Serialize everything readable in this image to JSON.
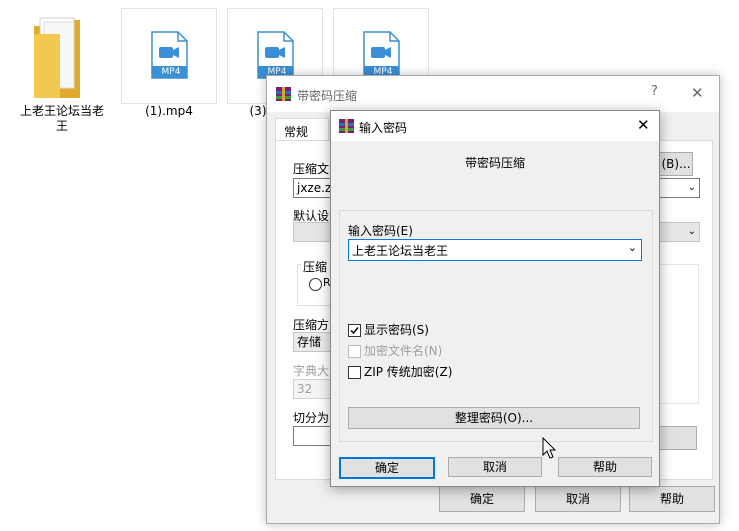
{
  "desktop": {
    "folder_name": "上老王论坛当老王",
    "files": [
      {
        "name": "(1).mp4",
        "badge": "MP4"
      },
      {
        "name": "(3)",
        "badge": "MP4"
      },
      {
        "name": "",
        "badge": "MP4"
      }
    ]
  },
  "back_dialog": {
    "title": "带密码压缩",
    "help_glyph": "?",
    "close_glyph": "✕",
    "tab_general": "常规",
    "label_archive": "压缩文",
    "archive_value": "jxze.zi",
    "browse_btn": "(B)...",
    "label_profile": "默认设",
    "label_format": "压缩",
    "radio_label": "R",
    "label_method": "压缩方",
    "method_value": "存储",
    "label_dict": "字典大",
    "dict_value": "32",
    "label_split": "切分为",
    "ok": "确定",
    "cancel": "取消",
    "help": "帮助"
  },
  "front_dialog": {
    "title": "输入密码",
    "close_glyph": "✕",
    "header": "带密码压缩",
    "password_label": "输入密码(E)",
    "password_value": "上老王论坛当老王",
    "show_password": {
      "label": "显示密码(S)",
      "checked": true
    },
    "encrypt_names": {
      "label": "加密文件名(N)",
      "checked": false,
      "disabled": true
    },
    "zip_legacy": {
      "label": "ZIP 传统加密(Z)",
      "checked": false
    },
    "organize_btn": "整理密码(O)...",
    "ok": "确定",
    "cancel": "取消",
    "help": "帮助"
  },
  "colors": {
    "icon_blue": "#3b8fd6",
    "folder_yellow": "#f3c851",
    "focus_blue": "#0078d7"
  }
}
